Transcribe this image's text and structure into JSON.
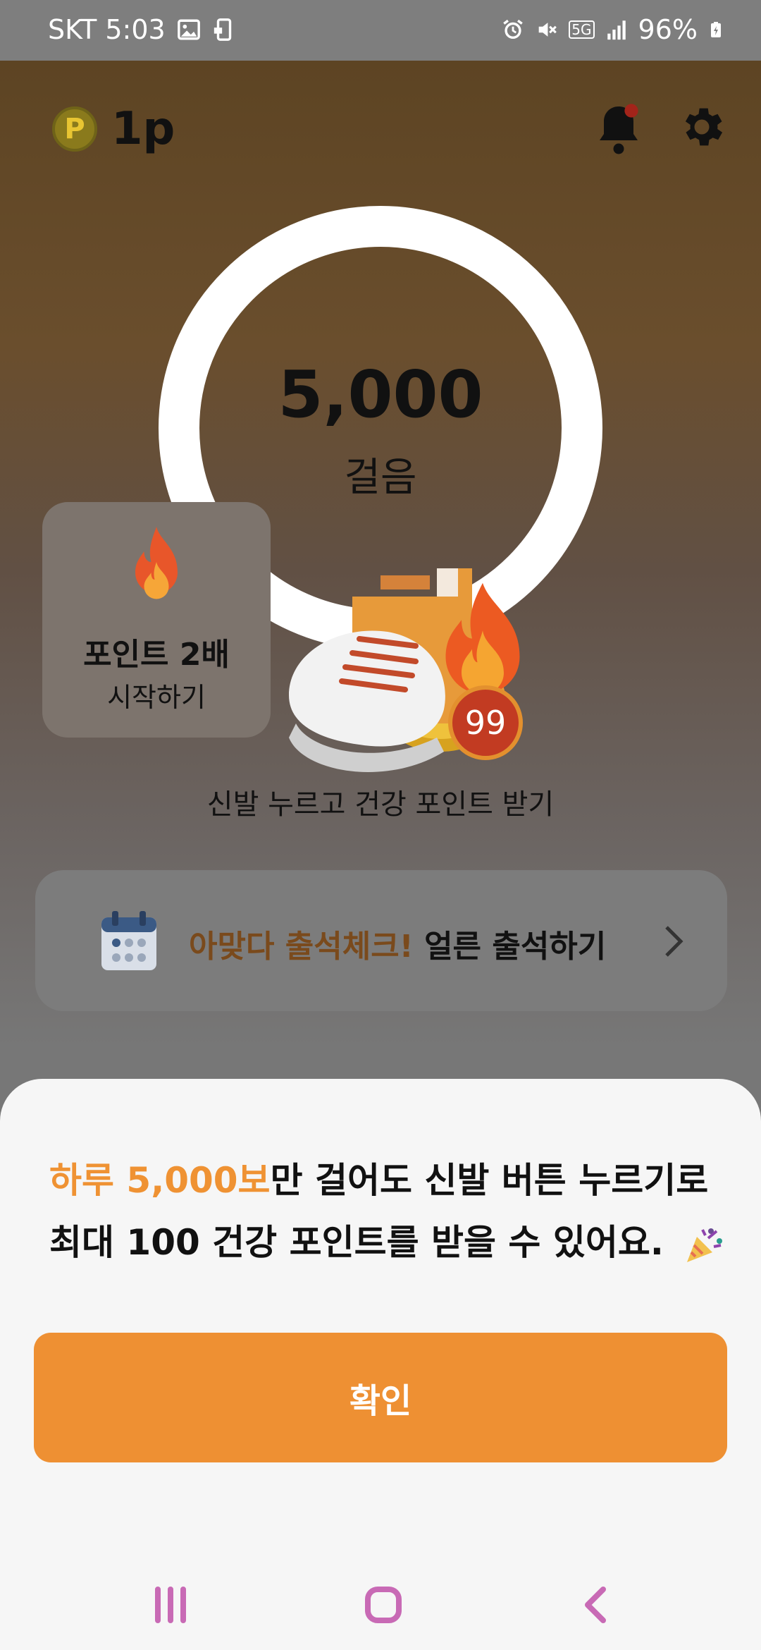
{
  "status_bar": {
    "carrier_time": "SKT 5:03",
    "network": "5G",
    "battery": "96%"
  },
  "header": {
    "points_symbol": "P",
    "points_value": "1p"
  },
  "steps": {
    "count": "5,000",
    "label": "걸음"
  },
  "double_points_card": {
    "title": "포인트 2배",
    "subtitle": "시작하기"
  },
  "shoe": {
    "badge": "99"
  },
  "hint": "신발 누르고 건강 포인트 받기",
  "attendance": {
    "highlight": "아맞다 출석체크!",
    "text": " 얼른 출석하기"
  },
  "sheet": {
    "line1_highlight": "하루 5,000보",
    "line1_rest": "만 걸어도 신발 버튼 누르기로",
    "line2": "최대 100 건강 포인트를 받을 수 있어요.",
    "confirm_label": "확인"
  },
  "colors": {
    "accent": "#ee9033",
    "highlight_text": "#ef9233",
    "badge_red": "#c23b22"
  }
}
